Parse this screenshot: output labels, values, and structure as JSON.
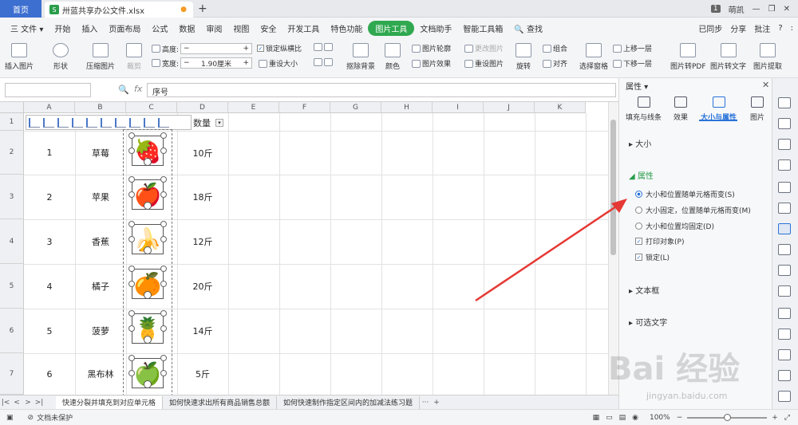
{
  "tabbar": {
    "home": "首页",
    "file_name": "卅蓝共享办公文件.xlsx",
    "user_badge": "1",
    "user_name": "萌凯"
  },
  "menu": {
    "file": "三 文件 ▾",
    "items": [
      "开始",
      "插入",
      "页面布局",
      "公式",
      "数据",
      "审阅",
      "视图",
      "安全",
      "开发工具",
      "特色功能",
      "图片工具",
      "文档助手",
      "智能工具箱"
    ],
    "active_index": 10,
    "search": "查找",
    "right": [
      "已同步",
      "分享",
      "批注",
      "?",
      ":"
    ]
  },
  "ribbon": {
    "insert_pic": "插入图片",
    "shape": "形状",
    "compress": "压缩图片",
    "crop": "裁剪",
    "height_label": "高度:",
    "height_value": "",
    "width_label": "宽度:",
    "width_value": "1.90厘米",
    "lock_ratio": "锁定纵横比",
    "reset_size": "重设大小",
    "remove_bg": "抠除背景",
    "color": "颜色",
    "outline": "图片轮廓",
    "effect": "图片效果",
    "change_pic": "更改图片",
    "reset_pic": "重设图片",
    "rotate": "旋转",
    "group": "组合",
    "align": "对齐",
    "select_pane": "选择窗格",
    "bring_forward": "上移一层",
    "send_backward": "下移一层",
    "to_pdf": "图片转PDF",
    "to_text": "图片转文字",
    "extract": "图片提取"
  },
  "formula": {
    "fx": "fx",
    "content": "序号"
  },
  "columns": [
    "A",
    "B",
    "C",
    "D",
    "E",
    "F",
    "G",
    "H",
    "I",
    "J",
    "K"
  ],
  "rows": [
    "1",
    "2",
    "3",
    "4",
    "5",
    "6",
    "7"
  ],
  "header": {
    "qty": "数量"
  },
  "table": [
    {
      "no": "1",
      "name": "草莓",
      "qty": "10斤",
      "fruit": "🍓"
    },
    {
      "no": "2",
      "name": "苹果",
      "qty": "18斤",
      "fruit": "🍎"
    },
    {
      "no": "3",
      "name": "香蕉",
      "qty": "12斤",
      "fruit": "🍌"
    },
    {
      "no": "4",
      "name": "橘子",
      "qty": "20斤",
      "fruit": "🍊"
    },
    {
      "no": "5",
      "name": "菠萝",
      "qty": "14斤",
      "fruit": "🍍"
    },
    {
      "no": "6",
      "name": "黑布林",
      "qty": "5斤",
      "fruit": "🍏"
    }
  ],
  "sheet_tabs": [
    "快速分裂并填充到对应单元格",
    "如何快速求出所有商品销售总额",
    "如何快速制作指定区间内的加减法练习题"
  ],
  "status": {
    "protect": "文档未保护",
    "zoom": "100%"
  },
  "pane": {
    "title": "属性 ▾",
    "tabs": [
      "填充与线条",
      "效果",
      "大小与属性",
      "图片"
    ],
    "active_tab": 2,
    "size_section": "大小",
    "prop_section": "属性",
    "radio_options": [
      "大小和位置随单元格而变(S)",
      "大小固定，位置随单元格而变(M)",
      "大小和位置均固定(D)"
    ],
    "checks": [
      "打印对象(P)",
      "锁定(L)"
    ],
    "textbox_section": "文本框",
    "alt_text_section": "可选文字"
  },
  "watermark": {
    "logo": "Bai 经验",
    "url": "jingyan.baidu.com"
  },
  "colors": {
    "accent": "#2fa84f",
    "home_tab": "#3d6fd0",
    "arrow": "#e53935",
    "pane_accent": "#2a73d9"
  }
}
